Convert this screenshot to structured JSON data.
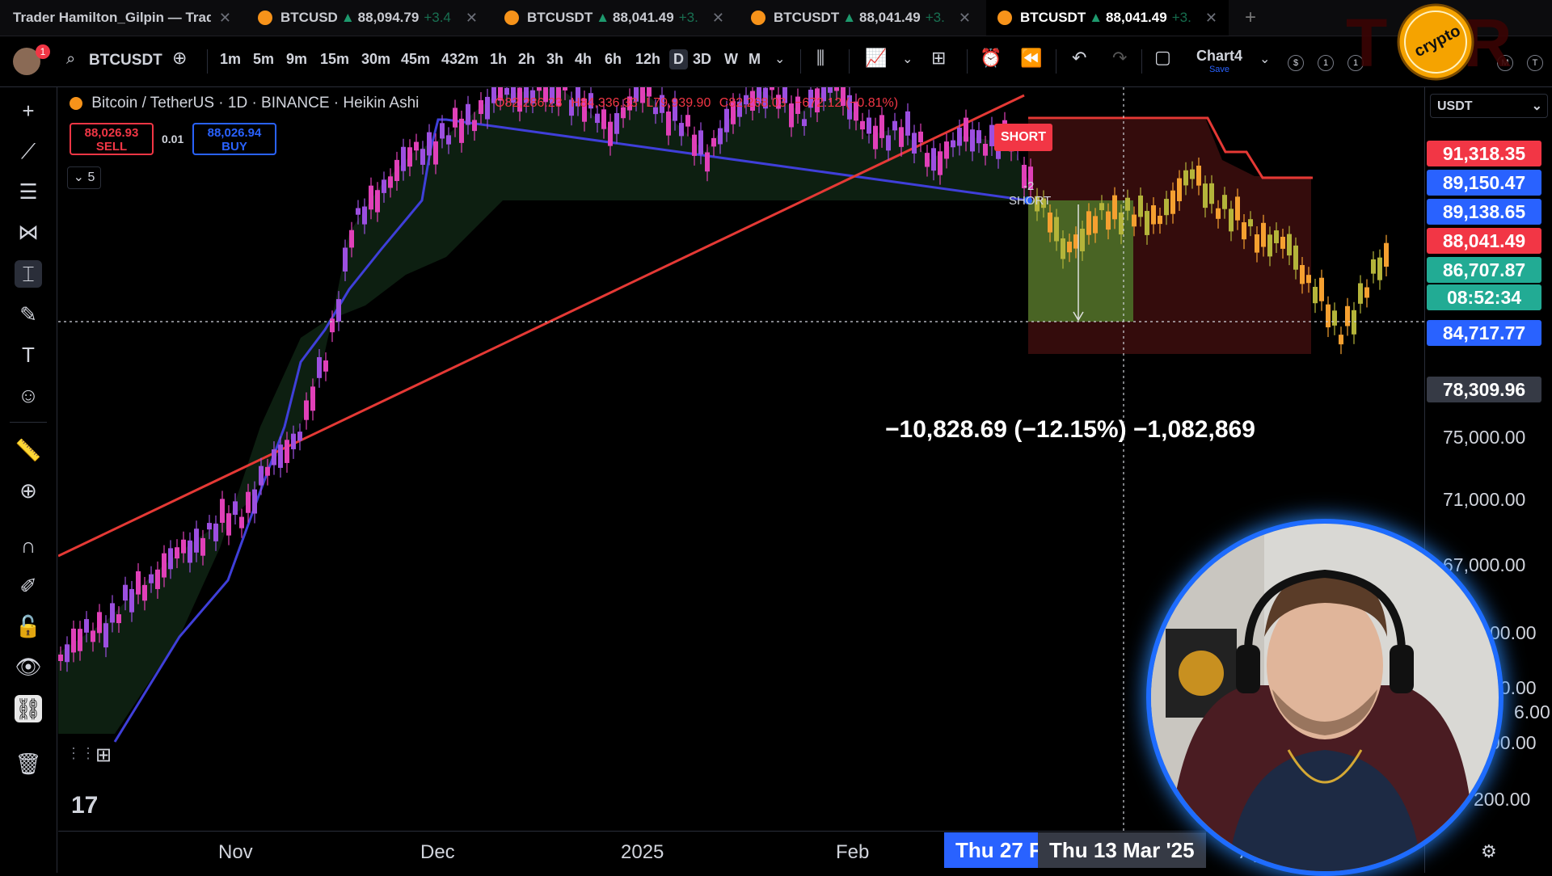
{
  "tabs": [
    {
      "title": "Trader Hamilton_Gilpin — Trad",
      "price": "",
      "change": "",
      "active": false
    },
    {
      "title": "BTCUSD",
      "price": "88,094.79",
      "change": "+3.4",
      "active": false
    },
    {
      "title": "BTCUSDT",
      "price": "88,041.49",
      "change": "+3.",
      "active": false
    },
    {
      "title": "BTCUSDT",
      "price": "88,041.49",
      "change": "+3.",
      "active": false
    },
    {
      "title": "BTCUSDT",
      "price": "88,041.49",
      "change": "+3.",
      "active": true
    }
  ],
  "toolbar": {
    "notification_count": "1",
    "symbol": "BTCUSDT",
    "timeframes": [
      "1m",
      "5m",
      "9m",
      "15m",
      "30m",
      "45m",
      "432m",
      "1h",
      "2h",
      "3h",
      "4h",
      "6h",
      "12h",
      "D",
      "3D",
      "W",
      "M"
    ],
    "selected_timeframe": "D",
    "layout_name": "Chart4",
    "layout_save": "Save",
    "circle_badges": [
      "$",
      "1",
      "1",
      "F",
      "M",
      "T"
    ]
  },
  "legend": {
    "title": "Bitcoin / TetherUS · 1D · BINANCE · Heikin Ashi",
    "open": "O82,286.23",
    "high": "H84,336.33",
    "low": "L79,939.90",
    "close": "C82,268.03",
    "change": "−672.12 (−0.81%)"
  },
  "trade": {
    "sell_price": "88,026.93",
    "sell_label": "SELL",
    "spread": "0.01",
    "buy_price": "88,026.94",
    "buy_label": "BUY",
    "indicator_count": "5"
  },
  "annotations": {
    "short_label": "SHORT",
    "short_count": "-2",
    "short_text": "SHORT",
    "measure": "−10,828.69 (−12.15%) −1,082,869"
  },
  "price_axis": {
    "currency": "USDT",
    "labels": [
      {
        "value": "91,318.35",
        "color": "#f23645"
      },
      {
        "value": "89,150.47",
        "color": "#2962ff"
      },
      {
        "value": "89,138.65",
        "color": "#2962ff"
      },
      {
        "value": "88,041.49",
        "color": "#f23645"
      },
      {
        "value": "86,707.87",
        "color": "#22ab94"
      },
      {
        "value": "08:52:34",
        "color": "#22ab94"
      },
      {
        "value": "84,717.77",
        "color": "#2962ff"
      },
      {
        "value": "78,309.96",
        "color": "#363a45"
      }
    ],
    "ticks": [
      "75,000.00",
      "71,000.00",
      "67,000.00",
      "00.00",
      "00.00",
      "6.00",
      "00.00",
      "200.00"
    ]
  },
  "time_axis": {
    "ticks": [
      "Nov",
      "Dec",
      "2025",
      "Feb",
      "Ap"
    ],
    "date_chip_1": "Thu 27 F",
    "date_chip_2": "Thu 13 Mar '25"
  },
  "logo_text": "crypto",
  "colors": {
    "bull": "#9c4fe0",
    "bear": "#e040b8",
    "trend": "#e53935",
    "supertrend": "#3f3fd9",
    "profit_zone": "#4f7a2a",
    "loss_zone": "#3a0d0d"
  },
  "chart_data": {
    "type": "candlestick",
    "symbol": "BTCUSDT",
    "interval": "1D",
    "style": "Heikin Ashi"
  }
}
